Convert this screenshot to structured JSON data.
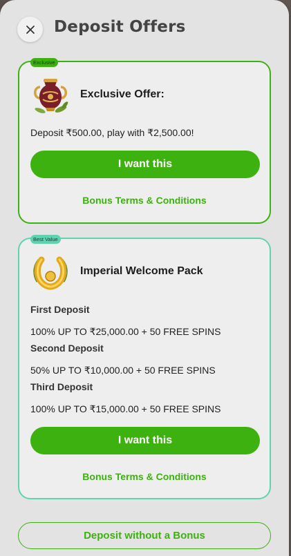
{
  "header": {
    "title": "Deposit Offers",
    "close_icon": "close-icon"
  },
  "offers": [
    {
      "badge": "Exclusive",
      "title": "Exclusive Offer:",
      "icon": "amphora-icon",
      "description": "Deposit ₹500.00, play with ₹2,500.00!",
      "button_label": "I want this",
      "terms_label": "Bonus Terms & Conditions",
      "accent": "#3cb10f"
    },
    {
      "badge": "Best Value",
      "title": "Imperial Welcome Pack",
      "icon": "golden-horseshoe-icon",
      "deposits": [
        {
          "label": "First Deposit",
          "value": "100% UP TO ₹25,000.00 + 50 FREE SPINS"
        },
        {
          "label": "Second Deposit",
          "value": "50% UP TO ₹10,000.00 + 50 FREE SPINS"
        },
        {
          "label": "Third Deposit",
          "value": "100% UP TO ₹15,000.00 + 50 FREE SPINS"
        }
      ],
      "button_label": "I want this",
      "terms_label": "Bonus Terms & Conditions",
      "accent": "#5fd3b0"
    }
  ],
  "footer": {
    "no_bonus_label": "Deposit without a Bonus"
  },
  "colors": {
    "primary_green": "#3cb10f",
    "teal": "#5fd3b0",
    "modal_bg": "#e3e3e3"
  }
}
